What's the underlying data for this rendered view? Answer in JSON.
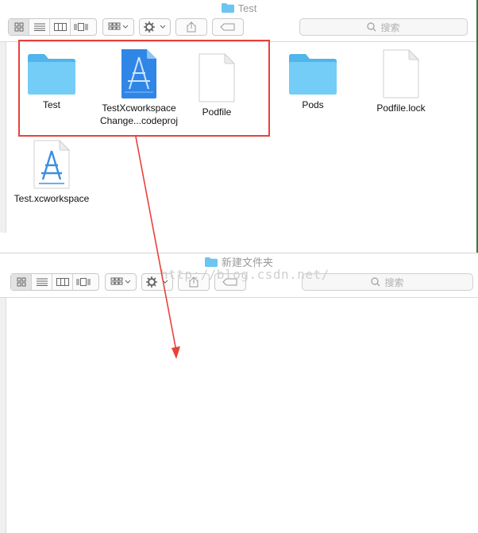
{
  "window1": {
    "title": "Test",
    "search_placeholder": "搜索",
    "items": [
      {
        "label_line1": "Test",
        "label_line2": "",
        "icon": "folder-icon"
      },
      {
        "label_line1": "TestXcworkspace",
        "label_line2": "Change...codeproj",
        "icon": "xcode-project-icon"
      },
      {
        "label_line1": "Podfile",
        "label_line2": "",
        "icon": "document-icon"
      },
      {
        "label_line1": "Pods",
        "label_line2": "",
        "icon": "folder-icon"
      },
      {
        "label_line1": "Podfile.lock",
        "label_line2": "",
        "icon": "document-icon"
      },
      {
        "label_line1": "Test.xcworkspace",
        "label_line2": "",
        "icon": "xcode-workspace-icon"
      }
    ]
  },
  "window2": {
    "title": "新建文件夹",
    "search_placeholder": "搜索"
  },
  "watermark": "http://blog.csdn.net/",
  "colors": {
    "highlight_box": "#e8413a",
    "arrow": "#e8413a",
    "folder": "#5bc0f0",
    "xcode_blue": "#2f86e6"
  }
}
